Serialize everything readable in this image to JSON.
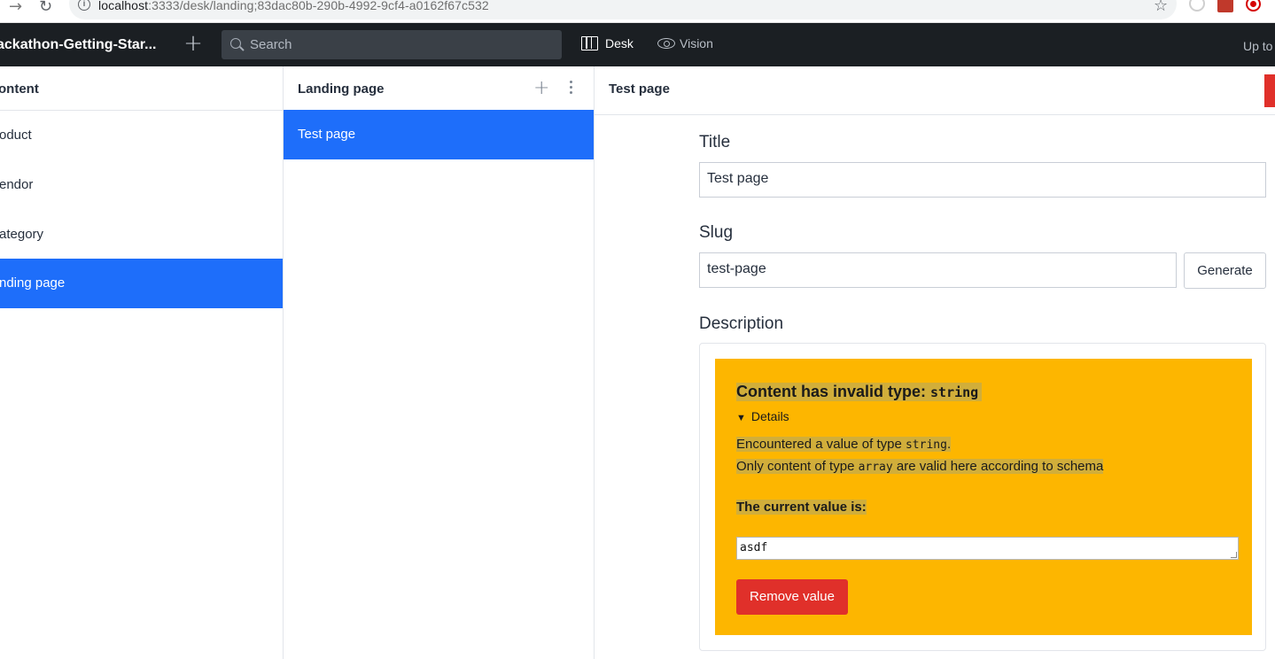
{
  "browser": {
    "url_host": "localhost",
    "url_rest": ":3333/desk/landing;83dac80b-290b-4992-9cf4-a0162f67c532",
    "info_glyph": "i"
  },
  "navbar": {
    "brand": "ackathon-Getting-Star...",
    "search_placeholder": "Search",
    "tools": {
      "desk": "Desk",
      "vision": "Vision"
    },
    "right_text": "Up to"
  },
  "content_pane": {
    "title": "ontent",
    "items": [
      {
        "label": "oduct"
      },
      {
        "label": "endor"
      },
      {
        "label": "ategory"
      },
      {
        "label": "nding page",
        "selected": true
      }
    ]
  },
  "landing_pane": {
    "title": "Landing page",
    "items": [
      {
        "label": "Test page",
        "selected": true
      }
    ]
  },
  "editor": {
    "title": "Test page",
    "fields": {
      "title": {
        "label": "Title",
        "value": "Test page"
      },
      "slug": {
        "label": "Slug",
        "value": "test-page",
        "button": "Generate"
      },
      "description": {
        "label": "Description"
      }
    },
    "warning": {
      "heading": "Content has invalid type: ",
      "heading_type": "string",
      "details": "Details",
      "line1_prefix": "Encountered a value of type ",
      "line1_type": "string",
      "line1_suffix": ".",
      "line2_prefix": "Only content of type ",
      "line2_type": "array",
      "line2_suffix": " are valid here according to schema",
      "current_value_label": "The current value is:",
      "current_value": "asdf",
      "remove_button": "Remove value"
    }
  },
  "colors": {
    "navbar_bg": "#1b1f23",
    "selected_bg": "#1e6efa",
    "warning_bg": "#fdb600",
    "danger": "#e0302a"
  }
}
